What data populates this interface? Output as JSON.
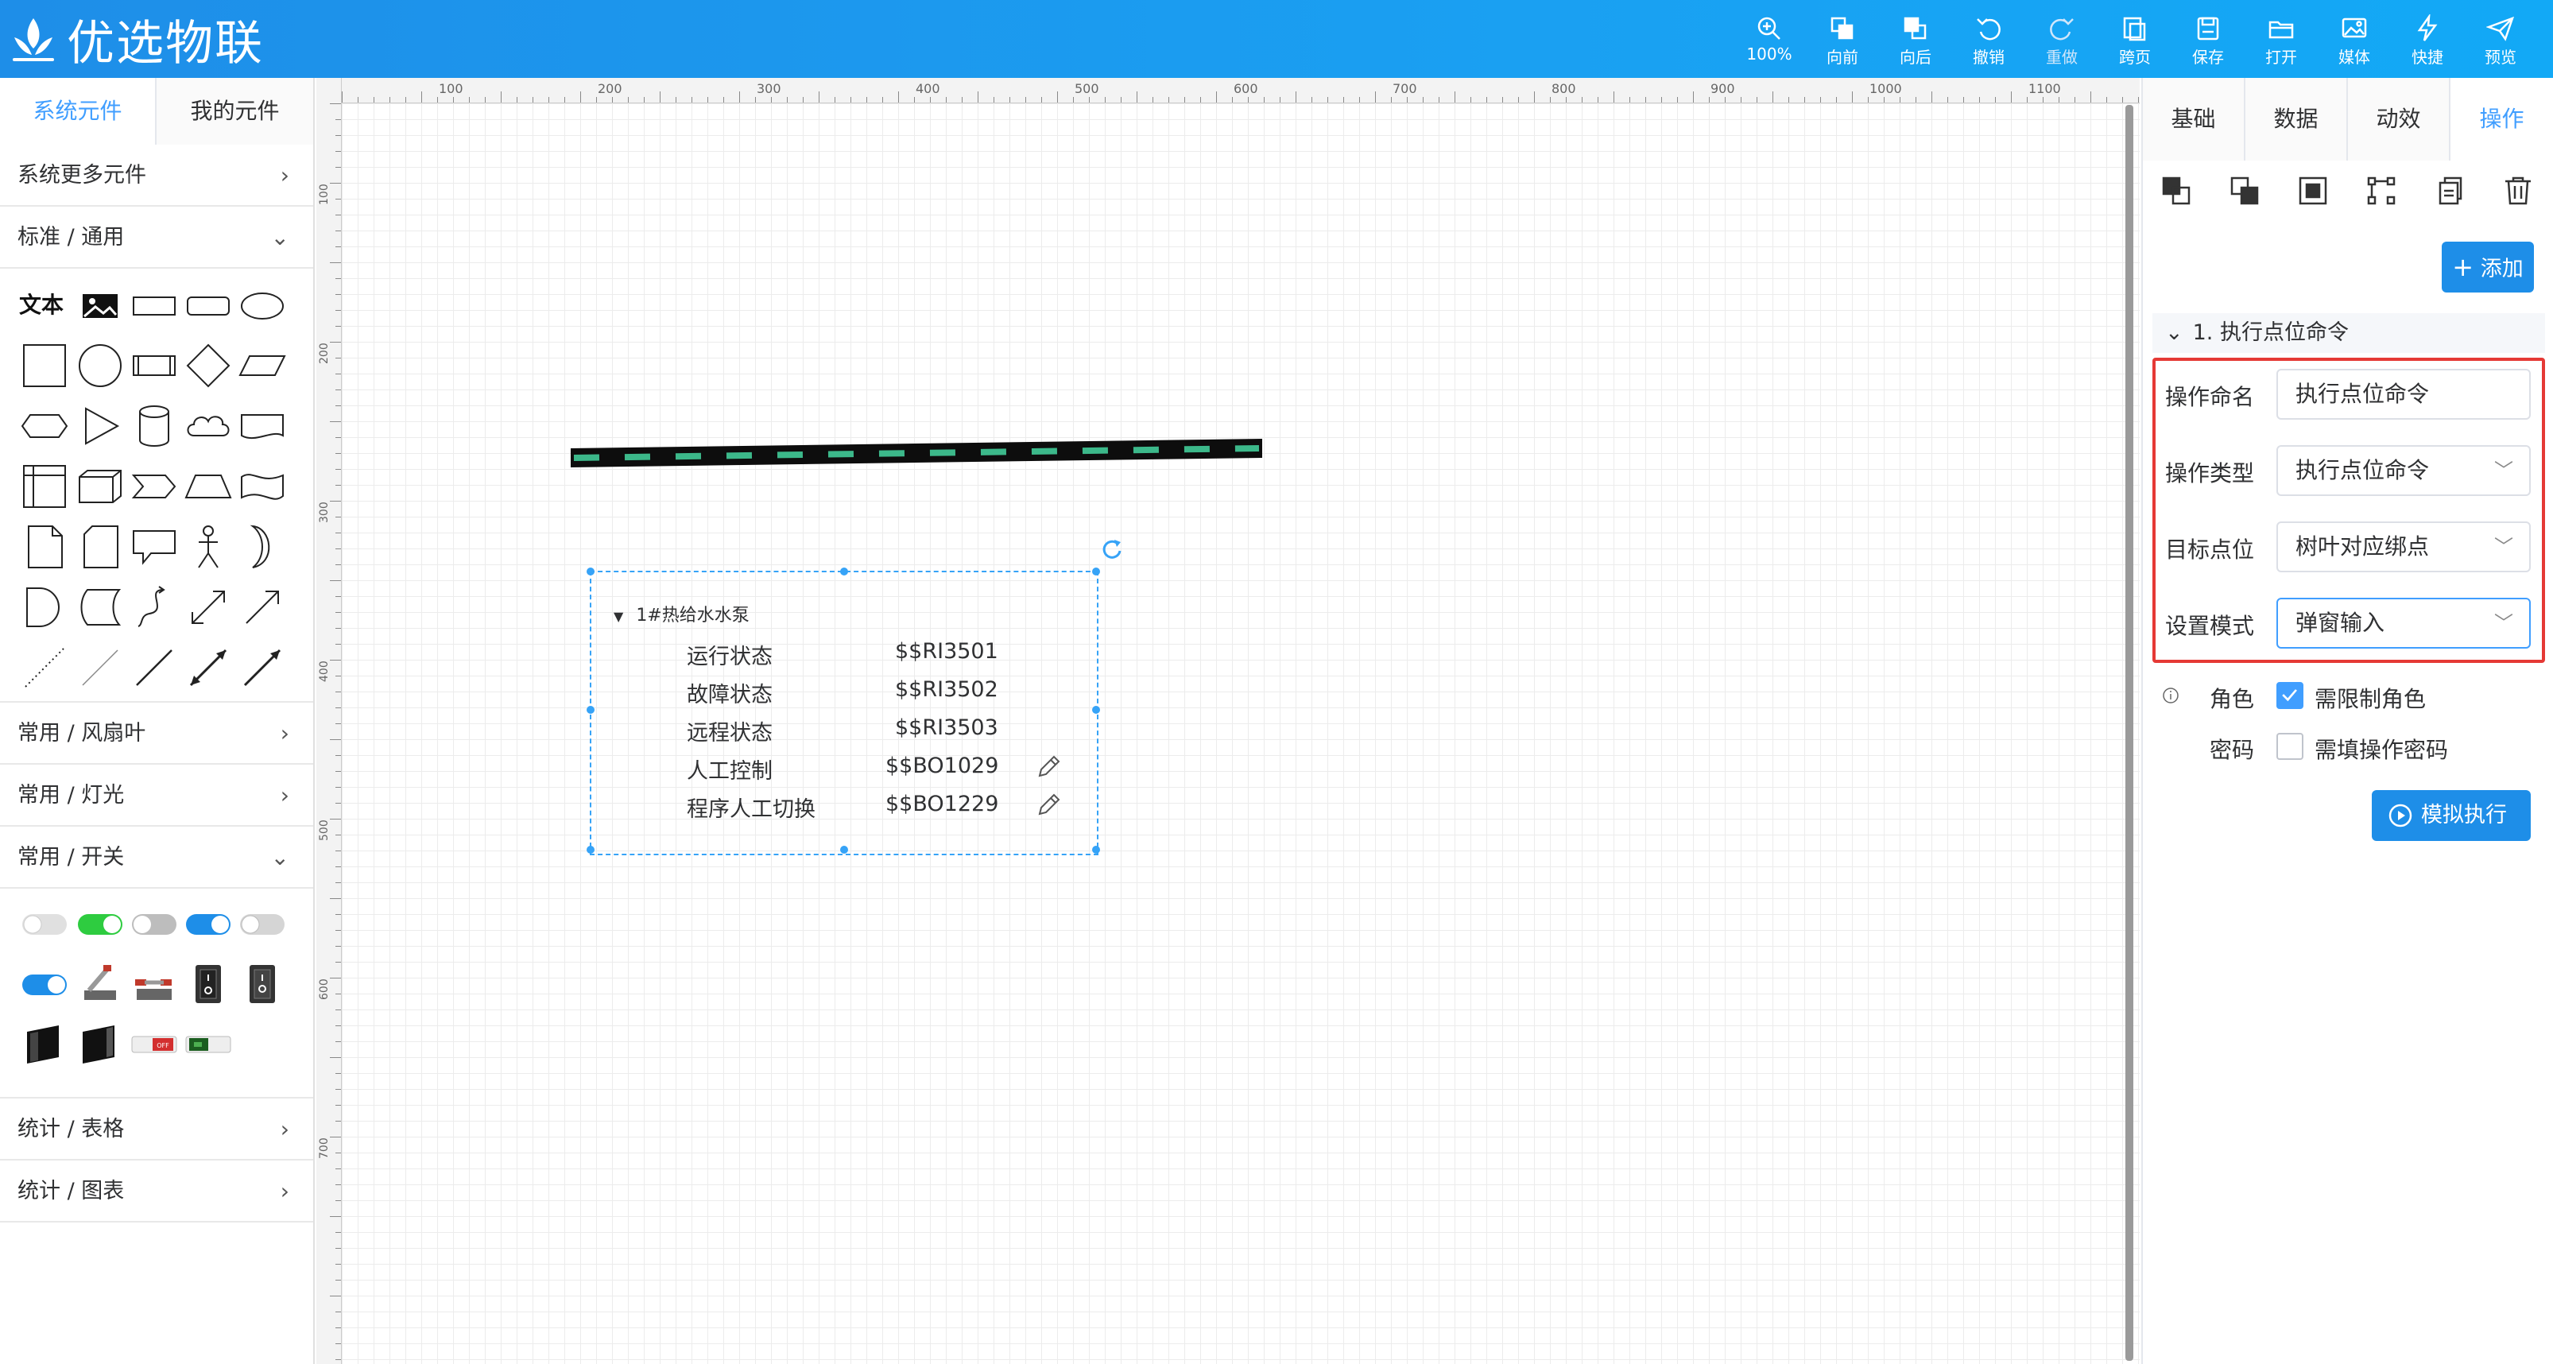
{
  "brand": {
    "title": "优选物联"
  },
  "toolbar": [
    {
      "label": "100%",
      "icon": "zoom-in-icon"
    },
    {
      "label": "向前",
      "icon": "bring-forward-icon"
    },
    {
      "label": "向后",
      "icon": "send-backward-icon"
    },
    {
      "label": "撤销",
      "icon": "undo-icon"
    },
    {
      "label": "重做",
      "icon": "redo-icon"
    },
    {
      "label": "跨页",
      "icon": "cross-page-icon"
    },
    {
      "label": "保存",
      "icon": "save-icon"
    },
    {
      "label": "打开",
      "icon": "folder-open-icon"
    },
    {
      "label": "媒体",
      "icon": "image-icon"
    },
    {
      "label": "快捷",
      "icon": "lightning-icon"
    },
    {
      "label": "预览",
      "icon": "send-icon"
    }
  ],
  "left_panel": {
    "tabs": [
      "系统元件",
      "我的元件"
    ],
    "categories": {
      "more": "系统更多元件",
      "standard": "标准 / 通用",
      "fan": "常用 / 风扇叶",
      "light": "常用 / 灯光",
      "switch": "常用 / 开关",
      "table": "统计 / 表格",
      "chart": "统计 / 图表"
    },
    "text_shape": "文本"
  },
  "ruler": {
    "top": [
      "100",
      "200",
      "300",
      "400",
      "500",
      "600",
      "700",
      "800",
      "900",
      "1000",
      "1100"
    ],
    "left": [
      "100",
      "200",
      "300",
      "400",
      "500",
      "600",
      "700"
    ]
  },
  "canvas": {
    "pump": {
      "title": "1#热给水水泵",
      "rows": [
        {
          "label": "运行状态",
          "value": "$$RI3501"
        },
        {
          "label": "故障状态",
          "value": "$$RI3502"
        },
        {
          "label": "远程状态",
          "value": "$$RI3503"
        },
        {
          "label": "人工控制",
          "value": "$$BO1029"
        },
        {
          "label": "程序人工切换",
          "value": "$$BO1229"
        }
      ]
    }
  },
  "right_panel": {
    "tabs": [
      "基础",
      "数据",
      "动效",
      "操作"
    ],
    "add_label": "添加",
    "section_title": "1. 执行点位命令",
    "fields": {
      "name_label": "操作命名",
      "name_value": "执行点位命令",
      "type_label": "操作类型",
      "type_value": "执行点位命令",
      "target_label": "目标点位",
      "target_value": "树叶对应绑点",
      "mode_label": "设置模式",
      "mode_value": "弹窗输入"
    },
    "role_label": "角色",
    "role_check": "需限制角色",
    "password_label": "密码",
    "password_check": "需填操作密码",
    "simulate_label": "模拟执行"
  },
  "colors": {
    "accent": "#409eff",
    "topbar": "#1e8ee8",
    "highlight": "#e53935"
  }
}
